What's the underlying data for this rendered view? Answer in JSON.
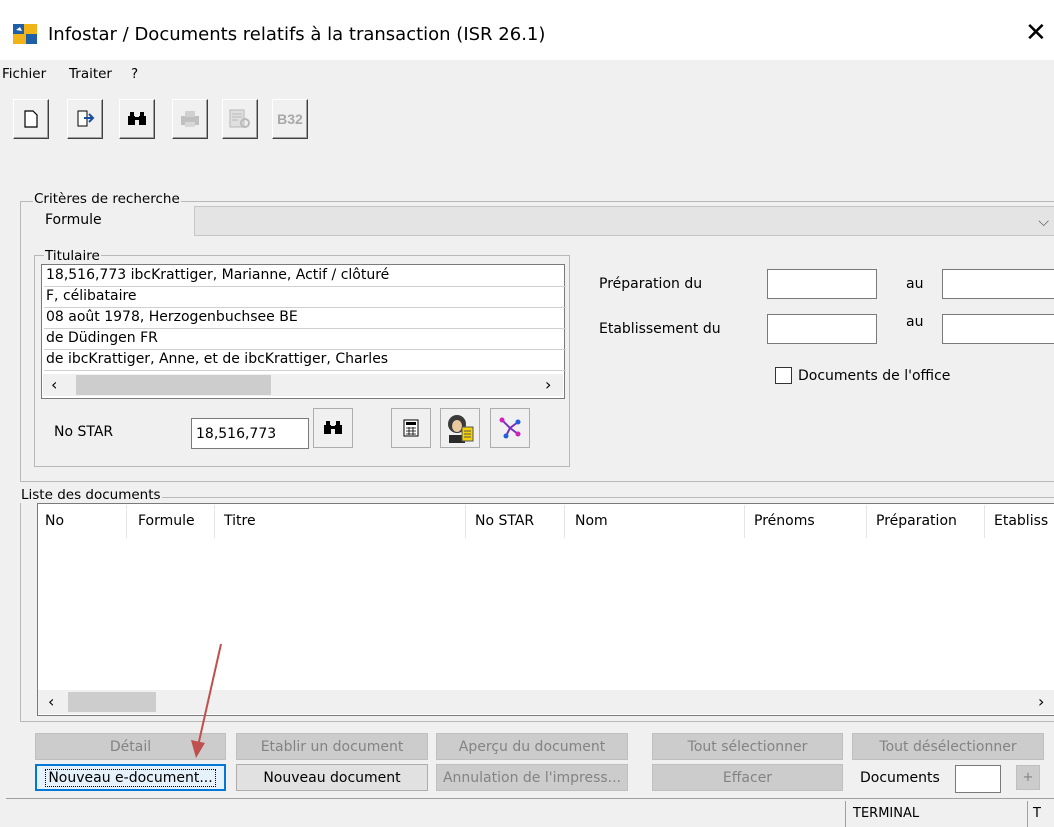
{
  "window": {
    "title": "Infostar / Documents relatifs à la transaction (ISR 26.1)"
  },
  "menu": [
    "Fichier",
    "Traiter",
    "?"
  ],
  "toolbar": {
    "buttons": [
      {
        "icon": "new-document-icon",
        "enabled": true
      },
      {
        "icon": "exit-door-icon",
        "enabled": true
      },
      {
        "icon": "binoculars-icon",
        "enabled": true
      },
      {
        "icon": "printer-icon",
        "enabled": false
      },
      {
        "icon": "print-preview-icon",
        "enabled": false
      },
      {
        "icon": "b32-icon",
        "label": "B32",
        "enabled": false
      }
    ]
  },
  "criteria": {
    "legend": "Critères de recherche",
    "formule_label": "Formule",
    "formule_value": "",
    "titulaire": {
      "legend": "Titulaire",
      "lines": [
        "18,516,773  ibcKrattiger, Marianne, Actif / clôturé",
        "F, célibataire",
        "08 août 1978, Herzogenbuchsee BE",
        "de Düdingen FR",
        "de ibcKrattiger, Anne, et de ibcKrattiger, Charles"
      ]
    },
    "no_star_label": "No STAR",
    "no_star_value": "18,516,773",
    "preparation_label": "Préparation du",
    "etablissement_label": "Etablissement du",
    "au_label": "au",
    "documents_office_label": "Documents de l'office",
    "documents_office_checked": false
  },
  "list": {
    "legend": "Liste des documents",
    "columns": [
      "No",
      "Formule",
      "Titre",
      "No STAR",
      "Nom",
      "Prénoms",
      "Préparation",
      "Etabliss"
    ],
    "rows": []
  },
  "buttons": {
    "detail": "Détail",
    "etablir": "Etablir un document",
    "apercu": "Aperçu du document",
    "tout_selectionner": "Tout sélectionner",
    "tout_deselectionner": "Tout désélectionner",
    "nouveau_e_document": "Nouveau e-document...",
    "nouveau_document": "Nouveau document",
    "annulation": "Annulation de l'impress...",
    "effacer": "Effacer",
    "documents_label": "Documents",
    "documents_value": "",
    "plus": "+"
  },
  "status": {
    "terminal": "TERMINAL",
    "extra": "T"
  },
  "colors": {
    "accent": "#0078d7",
    "annotation_arrow": "#c0504d"
  }
}
